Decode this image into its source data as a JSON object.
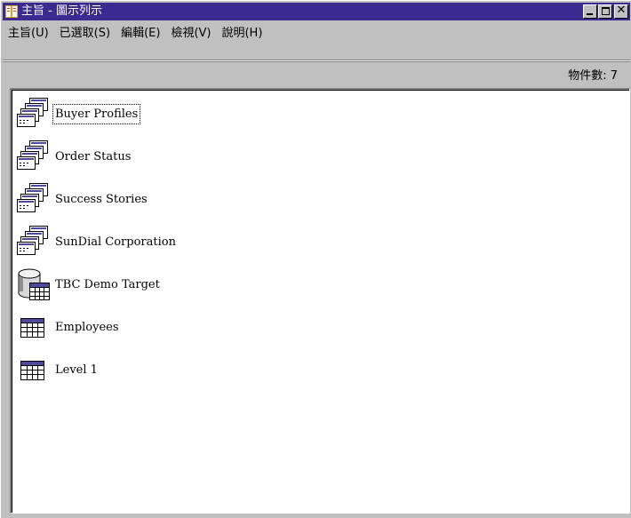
{
  "window": {
    "title": "主旨 - 圖示列示"
  },
  "menu": {
    "items": [
      "主旨(U)",
      "已選取(S)",
      "編輯(E)",
      "檢視(V)",
      "說明(H)"
    ]
  },
  "status": {
    "object_count": "物件數: 7"
  },
  "list": {
    "items": [
      {
        "label": "Buyer Profiles",
        "icon": "stacked-windows-icon",
        "selected": true
      },
      {
        "label": "Order Status",
        "icon": "stacked-windows-icon",
        "selected": false
      },
      {
        "label": "Success Stories",
        "icon": "stacked-windows-icon",
        "selected": false
      },
      {
        "label": "SunDial Corporation",
        "icon": "stacked-windows-icon",
        "selected": false
      },
      {
        "label": "TBC Demo Target",
        "icon": "database-table-icon",
        "selected": false
      },
      {
        "label": "Employees",
        "icon": "table-icon",
        "selected": false
      },
      {
        "label": "Level 1",
        "icon": "table-icon",
        "selected": false
      }
    ]
  },
  "colors": {
    "titlebar": "#3b2a8f",
    "face": "#c0c0c0",
    "content_bg": "#ffffff",
    "table_header": "#4b4b9b"
  }
}
